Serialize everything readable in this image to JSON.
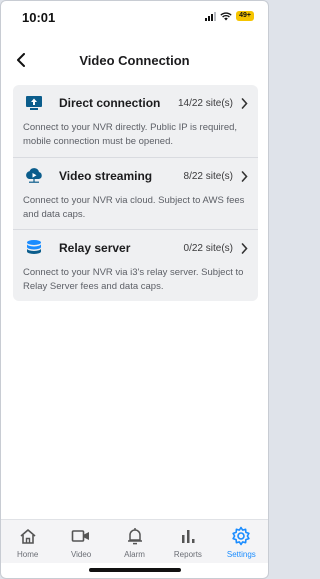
{
  "status_bar": {
    "time": "10:01",
    "battery": "49+"
  },
  "nav": {
    "title": "Video Connection",
    "back_icon": "chevron-left-icon"
  },
  "options": [
    {
      "title": "Direct connection",
      "count": "14/22 site(s)",
      "description": "Connect to your NVR directly. Public IP is required, mobile connection must be opened.",
      "icon": "upload-screen-icon"
    },
    {
      "title": "Video streaming",
      "count": "8/22 site(s)",
      "description": "Connect to your NVR via cloud. Subject to AWS fees and data caps.",
      "icon": "cloud-play-icon"
    },
    {
      "title": "Relay server",
      "count": "0/22 site(s)",
      "description": "Connect to your NVR via i3's relay server. Subject to Relay Server fees and data caps.",
      "icon": "database-icon"
    }
  ],
  "tabs": [
    {
      "label": "Home",
      "icon": "home-icon"
    },
    {
      "label": "Video",
      "icon": "video-camera-icon"
    },
    {
      "label": "Alarm",
      "icon": "bell-icon"
    },
    {
      "label": "Reports",
      "icon": "bar-chart-icon"
    },
    {
      "label": "Settings",
      "icon": "gear-icon",
      "active": true
    }
  ],
  "colors": {
    "accent": "#1a8cff",
    "icon_dark": "#0b5d8c",
    "card_bg": "#eff0f2"
  }
}
